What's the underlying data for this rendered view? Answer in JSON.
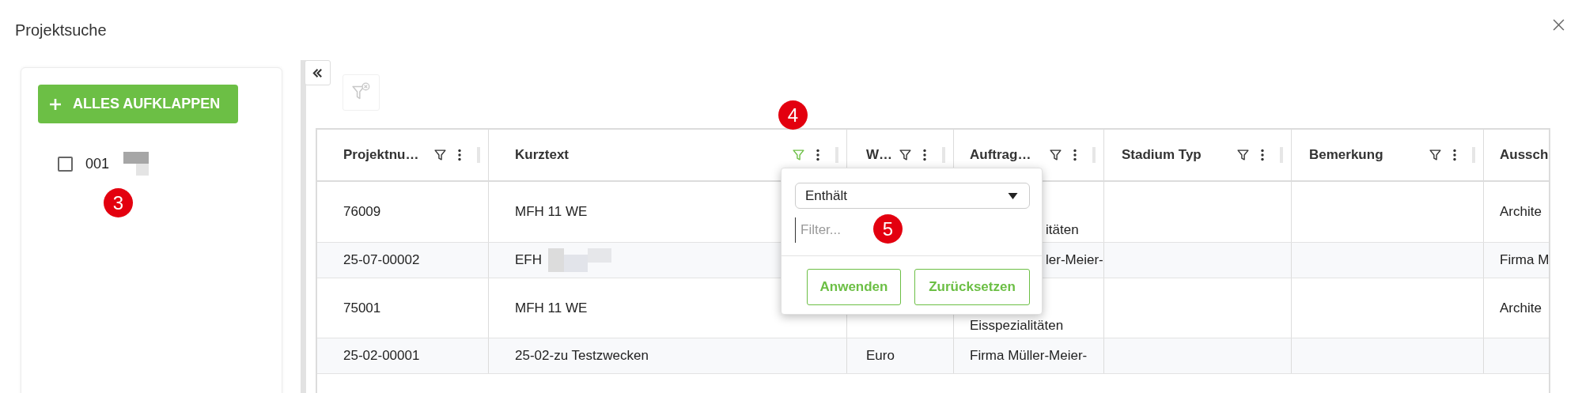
{
  "window": {
    "title": "Projektsuche"
  },
  "tree": {
    "expand_all_button": "ALLES AUFKLAPPEN",
    "items": [
      {
        "label": "001",
        "checked": false,
        "redacted": true
      }
    ],
    "callout": "3"
  },
  "table": {
    "callout": "4",
    "columns": [
      {
        "label": "Projektnu…",
        "filter_active": false
      },
      {
        "label": "Kurztext",
        "filter_active": true
      },
      {
        "label": "W…",
        "filter_active": false
      },
      {
        "label": "Auftrag…",
        "filter_active": false
      },
      {
        "label": "Stadium Typ",
        "filter_active": false
      },
      {
        "label": "Bemerkung",
        "filter_active": false
      },
      {
        "label": "Aussch"
      }
    ],
    "rows": [
      {
        "cells": [
          "76009",
          "MFH 11 WE",
          null,
          "itäten",
          null,
          null,
          "Archite"
        ],
        "redacted": false
      },
      {
        "cells": [
          "25-07-00002",
          "EFH",
          null,
          "ler-Meier-",
          null,
          null,
          "Firma M"
        ],
        "redacted": true
      },
      {
        "cells": [
          "75001",
          "MFH 11 WE",
          null,
          "Eisspezialitäten",
          null,
          null,
          "Archite"
        ],
        "redacted": false
      },
      {
        "cells": [
          "25-02-00001",
          "25-02-zu Testzwecken",
          "Euro",
          "Firma Müller-Meier-",
          null,
          null,
          null
        ],
        "redacted": false
      }
    ]
  },
  "filter_popup": {
    "operator": "Enthält",
    "placeholder": "Filter...",
    "callout": "5",
    "buttons": [
      "Anwenden",
      "Zurücksetzen"
    ]
  }
}
